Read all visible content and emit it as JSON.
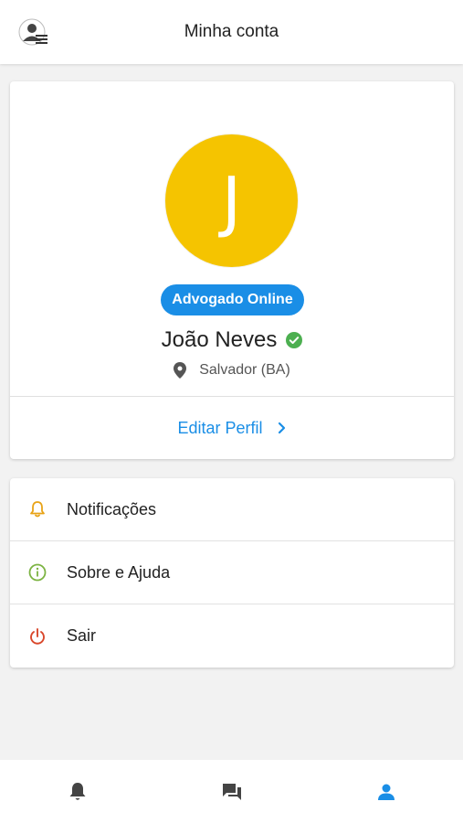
{
  "header": {
    "title": "Minha conta",
    "menu_icon": "user-menu-icon"
  },
  "profile": {
    "avatar_initial": "J",
    "avatar_color": "#f5c400",
    "role_badge": "Advogado Online",
    "name": "João Neves",
    "verified_icon": "check-circle-icon",
    "location_icon": "map-pin-icon",
    "location": "Salvador (BA)",
    "edit_label": "Editar Perfil"
  },
  "menu": {
    "items": [
      {
        "label": "Notificações",
        "icon": "bell-outline-icon",
        "color": "#e8a317"
      },
      {
        "label": "Sobre e Ajuda",
        "icon": "info-circle-icon",
        "color": "#7cb342"
      },
      {
        "label": "Sair",
        "icon": "power-icon",
        "color": "#d9472b"
      }
    ]
  },
  "bottom_nav": {
    "items": [
      {
        "icon": "bell-icon",
        "active": false
      },
      {
        "icon": "chat-icon",
        "active": false
      },
      {
        "icon": "person-icon",
        "active": true
      }
    ],
    "active_color": "#1a8ee6",
    "inactive_color": "#444444"
  },
  "colors": {
    "accent": "#1a8ee6",
    "background": "#f2f2f2",
    "verified_green": "#4caf50"
  }
}
